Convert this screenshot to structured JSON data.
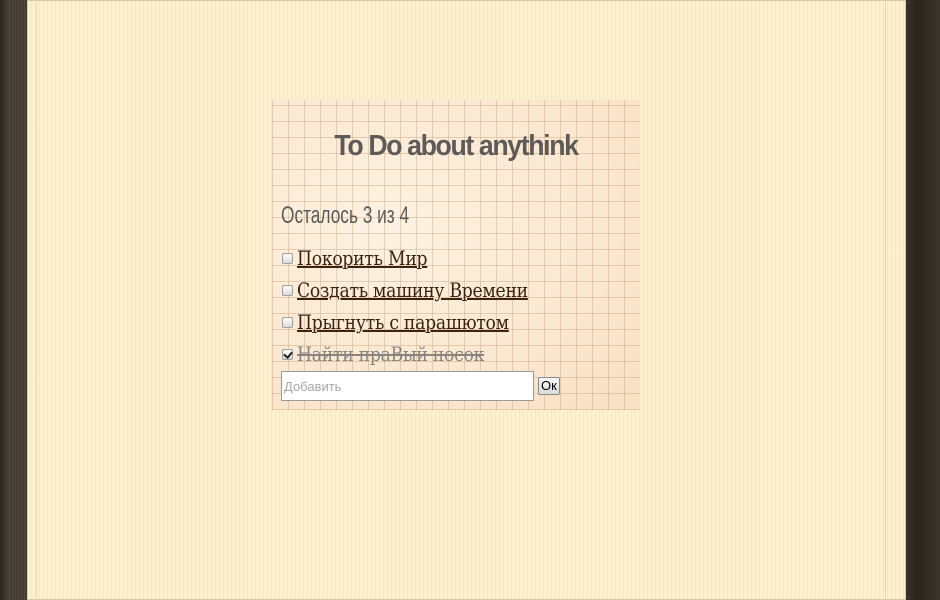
{
  "app": {
    "title": "To Do about anythink",
    "remaining_text": "Осталось 3 из 4"
  },
  "todos": [
    {
      "label": "Покорить Мир",
      "done": false
    },
    {
      "label": "Создать машину Времени",
      "done": false
    },
    {
      "label": "Прыгнуть с парашютом",
      "done": false
    },
    {
      "label": "Найти праВый носок",
      "done": true
    }
  ],
  "add_form": {
    "placeholder": "Добавить",
    "value": "",
    "submit_label": "Ок"
  }
}
